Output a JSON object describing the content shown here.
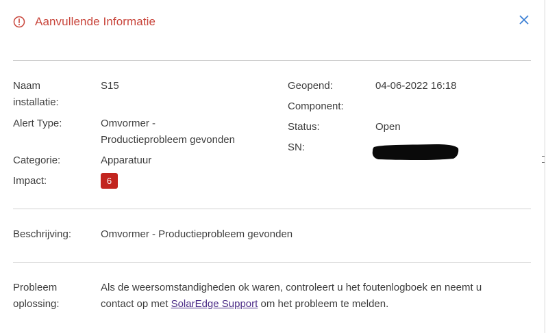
{
  "header": {
    "title": "Aanvullende Informatie",
    "info_icon": "info-circle-icon",
    "close_icon": "close-x-icon"
  },
  "colors": {
    "title": "#c8443a",
    "close": "#3b7fd4",
    "badge_bg": "#c2251f",
    "link": "#4a2a86",
    "divider": "#cfcfcf"
  },
  "details": {
    "naam_label_line1": "Naam",
    "naam_label_line2": "installatie:",
    "naam_value": "S15",
    "alert_type_label": "Alert Type:",
    "alert_type_value_line1": "Omvormer -",
    "alert_type_value_line2": "Productieprobleem gevonden",
    "categorie_label": "Categorie:",
    "categorie_value": "Apparatuur",
    "impact_label": "Impact:",
    "impact_value": "6",
    "geopend_label": "Geopend:",
    "geopend_value": "04-06-2022 16:18",
    "component_label": "Component:",
    "component_value": "",
    "status_label": "Status:",
    "status_value": "Open",
    "sn_label": "SN:"
  },
  "description": {
    "label": "Beschrijving:",
    "value": "Omvormer - Productieprobleem gevonden"
  },
  "solution": {
    "label_line1": "Probleem",
    "label_line2": "oplossing:",
    "text_line1": "Als de weersomstandigheden ok waren, controleert u het foutenlogboek en neemt u",
    "text_prefix": "contact op met ",
    "link_text": "SolarEdge Support",
    "text_suffix": " om het probleem te melden."
  }
}
